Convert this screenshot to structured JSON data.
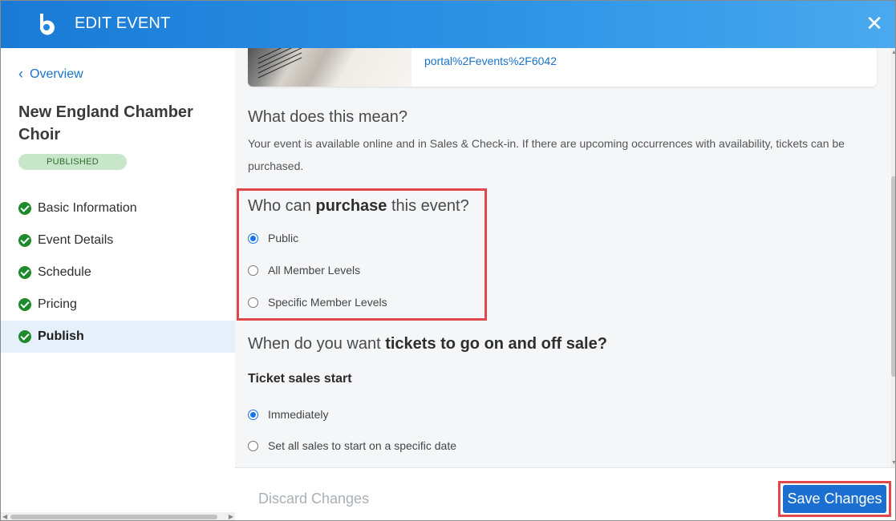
{
  "header": {
    "title": "EDIT EVENT",
    "close_icon": "close-icon",
    "logo_icon": "brand-logo"
  },
  "sidebar": {
    "back_label": "Overview",
    "event_name": "New England Chamber Choir",
    "status_badge": "PUBLISHED",
    "status_color": "#c8e6c9",
    "items": [
      {
        "label": "Basic Information",
        "icon": "check-circle-icon",
        "active": false
      },
      {
        "label": "Event Details",
        "icon": "check-circle-icon",
        "active": false
      },
      {
        "label": "Schedule",
        "icon": "check-circle-icon",
        "active": false
      },
      {
        "label": "Pricing",
        "icon": "check-circle-icon",
        "active": false
      },
      {
        "label": "Publish",
        "icon": "check-circle-icon",
        "active": true
      }
    ]
  },
  "main": {
    "card_link": "portal%2Fevents%2F6042",
    "meaning": {
      "heading": "What does this mean?",
      "body": "Your event is available online and in Sales & Check-in. If there are upcoming occurrences with availability, tickets can be purchased."
    },
    "purchase": {
      "heading_pre": "Who can ",
      "heading_bold": "purchase",
      "heading_post": " this event?",
      "options": [
        {
          "label": "Public",
          "selected": true
        },
        {
          "label": "All Member Levels",
          "selected": false
        },
        {
          "label": "Specific Member Levels",
          "selected": false
        }
      ]
    },
    "sale": {
      "heading_pre": "When do you want ",
      "heading_bold": "tickets to go on and off sale?",
      "start_label": "Ticket sales start",
      "options": [
        {
          "label": "Immediately",
          "selected": true
        },
        {
          "label": "Set all sales to start on a specific date",
          "selected": false
        }
      ]
    }
  },
  "footer": {
    "discard_label": "Discard Changes",
    "save_label": "Save Changes"
  },
  "colors": {
    "accent": "#1a6fd1",
    "highlight": "#e0484c",
    "success": "#1f8a2c"
  }
}
